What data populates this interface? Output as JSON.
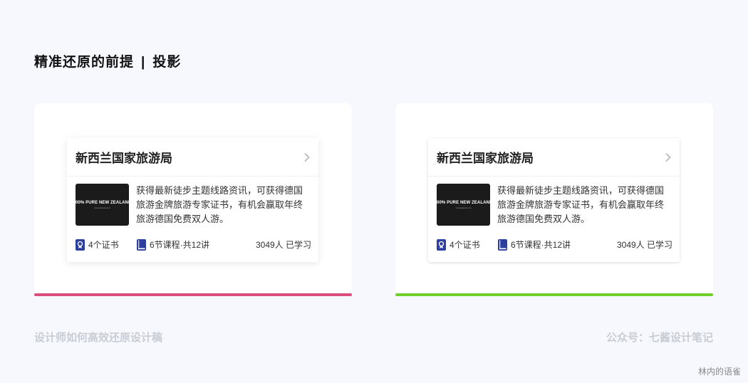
{
  "heading": {
    "title": "精准还原的前提",
    "separator": "|",
    "subtitle": "投影"
  },
  "colors": {
    "left_accent": "#d94e7d",
    "right_accent": "#6fcf2b",
    "icon_blue": "#2d3f9e"
  },
  "cards": [
    {
      "title": "新西兰国家旅游局",
      "thumb_text": "100% PURE NEW ZEALAND",
      "thumb_sub": "newzealand.com",
      "description": "获得最新徒步主题线路资讯，可获得德国旅游金牌旅游专家证书，有机会赢取年终旅游德国免费双人游。",
      "certificates": "4个证书",
      "courses": "6节课程·共12讲",
      "learners": "3049人 已学习"
    },
    {
      "title": "新西兰国家旅游局",
      "thumb_text": "100% PURE NEW ZEALAND",
      "thumb_sub": "newzealand.com",
      "description": "获得最新徒步主题线路资讯，可获得德国旅游金牌旅游专家证书，有机会赢取年终旅游德国免费双人游。",
      "certificates": "4个证书",
      "courses": "6节课程·共12讲",
      "learners": "3049人 已学习"
    }
  ],
  "captions": {
    "left": "设计师如何高效还原设计稿",
    "right": "公众号：七酱设计笔记"
  },
  "watermark": "林内的语雀",
  "icons": {
    "chevron": "chevron-right-icon",
    "certificate": "certificate-icon",
    "course": "book-icon"
  }
}
